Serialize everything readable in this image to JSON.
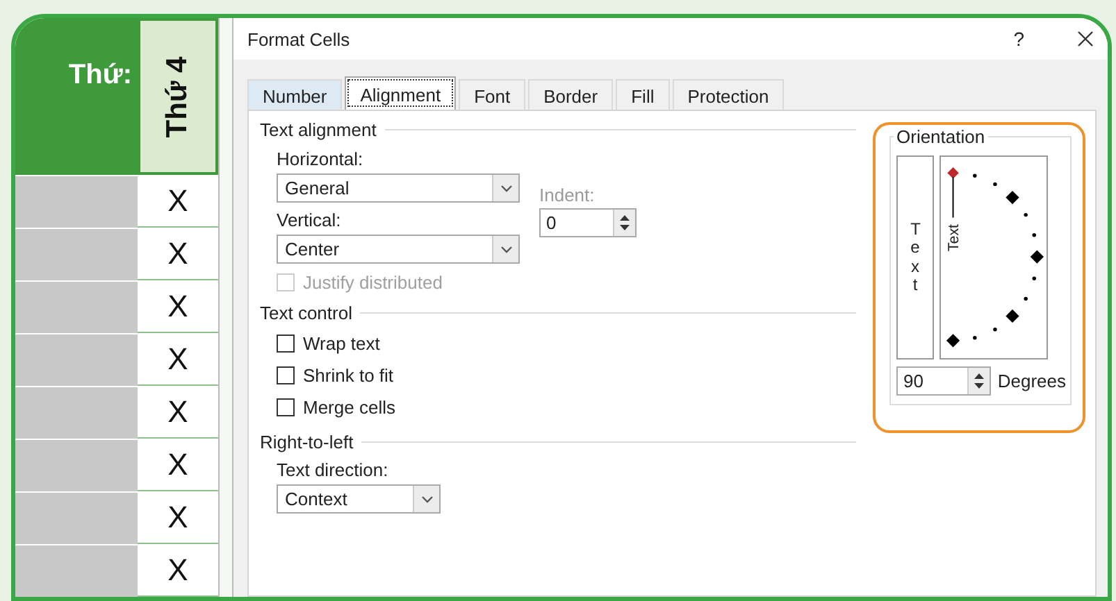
{
  "sheet": {
    "header_label": "Thứ:",
    "column_header": "Thứ 4",
    "rows": [
      "X",
      "X",
      "X",
      "X",
      "X",
      "X",
      "X",
      "X"
    ]
  },
  "dialog": {
    "title": "Format Cells",
    "help": "?",
    "tabs": [
      {
        "label": "Number",
        "selected": false
      },
      {
        "label": "Alignment",
        "selected": true
      },
      {
        "label": "Font",
        "selected": false
      },
      {
        "label": "Border",
        "selected": false
      },
      {
        "label": "Fill",
        "selected": false
      },
      {
        "label": "Protection",
        "selected": false
      }
    ],
    "text_alignment": {
      "title": "Text alignment",
      "horizontal": {
        "label": "Horizontal:",
        "value": "General"
      },
      "vertical": {
        "label": "Vertical:",
        "value": "Center"
      },
      "indent": {
        "label": "Indent:",
        "value": "0",
        "disabled": true
      },
      "justify_distributed": {
        "label": "Justify distributed",
        "checked": false,
        "disabled": true
      }
    },
    "text_control": {
      "title": "Text control",
      "options": [
        {
          "label": "Wrap text",
          "checked": false
        },
        {
          "label": "Shrink to fit",
          "checked": false
        },
        {
          "label": "Merge cells",
          "checked": false
        }
      ]
    },
    "right_to_left": {
      "title": "Right-to-left",
      "text_direction": {
        "label": "Text direction:",
        "value": "Context"
      }
    },
    "orientation": {
      "title": "Orientation",
      "highlighted": true,
      "vertical_text": "Text",
      "rotated_text": "Text",
      "degrees": {
        "value": "90",
        "label": "Degrees"
      }
    }
  }
}
